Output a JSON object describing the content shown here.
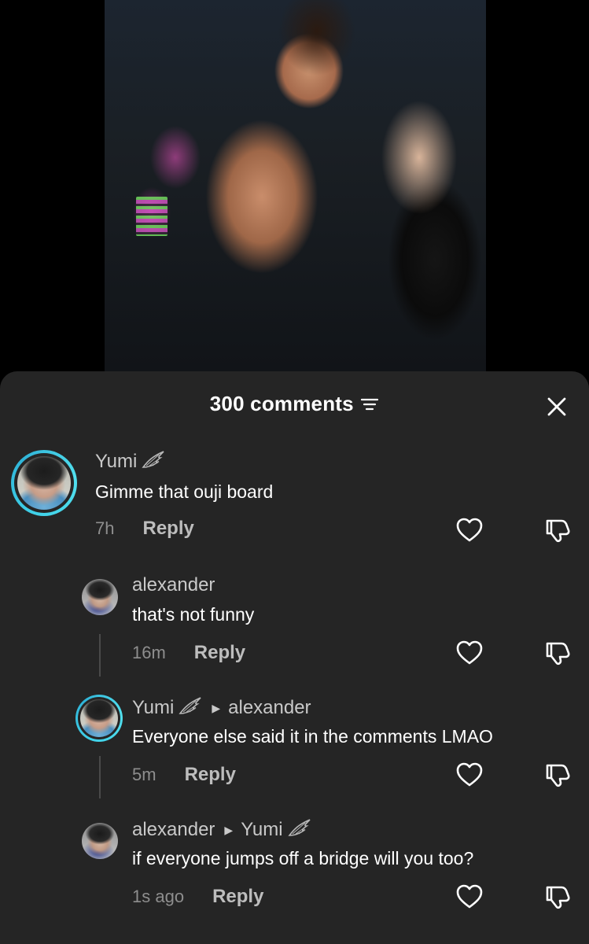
{
  "header": {
    "comment_count": "300 comments"
  },
  "comments": [
    {
      "username": "Yumi",
      "text": "Gimme that ouji board",
      "time": "7h",
      "reply_label": "Reply"
    },
    {
      "username": "alexander",
      "text": "that's not funny",
      "time": "16m",
      "reply_label": "Reply"
    },
    {
      "username": "Yumi",
      "reply_to": "alexander",
      "text": "Everyone else said it in the comments LMAO",
      "time": "5m",
      "reply_label": "Reply"
    },
    {
      "username": "alexander",
      "reply_to": "Yumi",
      "text": "if everyone jumps off a bridge will you too?",
      "time": "1s ago",
      "reply_label": "Reply"
    }
  ],
  "icons": {
    "filter": "filter-icon",
    "close": "close-icon",
    "like": "heart-icon",
    "dislike": "dislike-icon",
    "badge": "wing-icon"
  },
  "colors": {
    "sheet_bg": "#252525",
    "ring": "#3fd0e8",
    "text_primary": "#ffffff",
    "text_secondary": "#8e8e8e"
  }
}
